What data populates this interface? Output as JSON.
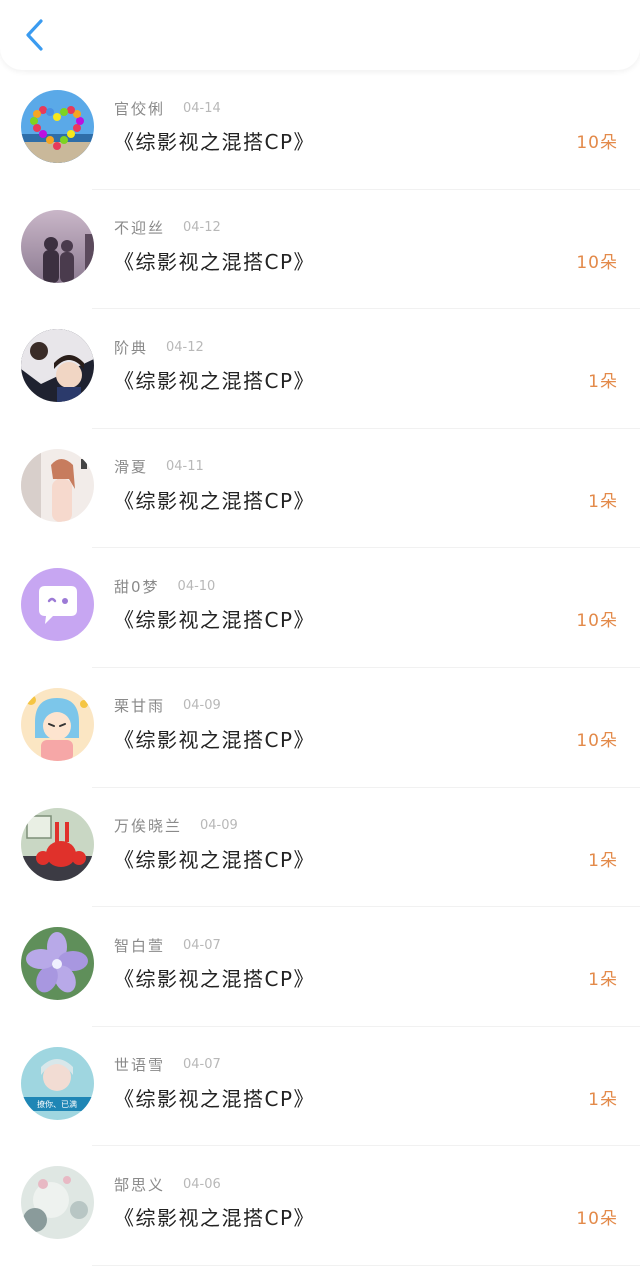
{
  "header": {
    "back_icon": "chevron-left-icon",
    "accent_color": "#3a9bf0"
  },
  "count_color": "#e38a4a",
  "items": [
    {
      "name": "官佼俐",
      "date": "04-14",
      "title": "《综影视之混搭CP》",
      "count": "10朵",
      "avatar": "heart-balloons"
    },
    {
      "name": "不迎丝",
      "date": "04-12",
      "title": "《综影视之混搭CP》",
      "count": "10朵",
      "avatar": "couple-silhouette"
    },
    {
      "name": "阶典",
      "date": "04-12",
      "title": "《综影视之混搭CP》",
      "count": "1朵",
      "avatar": "anime-boy"
    },
    {
      "name": "滑夏",
      "date": "04-11",
      "title": "《综影视之混搭CP》",
      "count": "1朵",
      "avatar": "girl-photo"
    },
    {
      "name": "甜0梦",
      "date": "04-10",
      "title": "《综影视之混搭CP》",
      "count": "10朵",
      "avatar": "chat-bubble"
    },
    {
      "name": "栗甘雨",
      "date": "04-09",
      "title": "《综影视之混搭CP》",
      "count": "10朵",
      "avatar": "cartoon-character"
    },
    {
      "name": "万俟晓兰",
      "date": "04-09",
      "title": "《综影视之混搭CP》",
      "count": "1朵",
      "avatar": "red-lobster"
    },
    {
      "name": "智白萱",
      "date": "04-07",
      "title": "《综影视之混搭CP》",
      "count": "1朵",
      "avatar": "purple-flower"
    },
    {
      "name": "世语雪",
      "date": "04-07",
      "title": "《综影视之混搭CP》",
      "count": "1朵",
      "avatar": "teal-portrait",
      "avatar_caption": "撩你、已满"
    },
    {
      "name": "郜思义",
      "date": "04-06",
      "title": "《综影视之混搭CP》",
      "count": "10朵",
      "avatar": "pale-illustration"
    }
  ]
}
